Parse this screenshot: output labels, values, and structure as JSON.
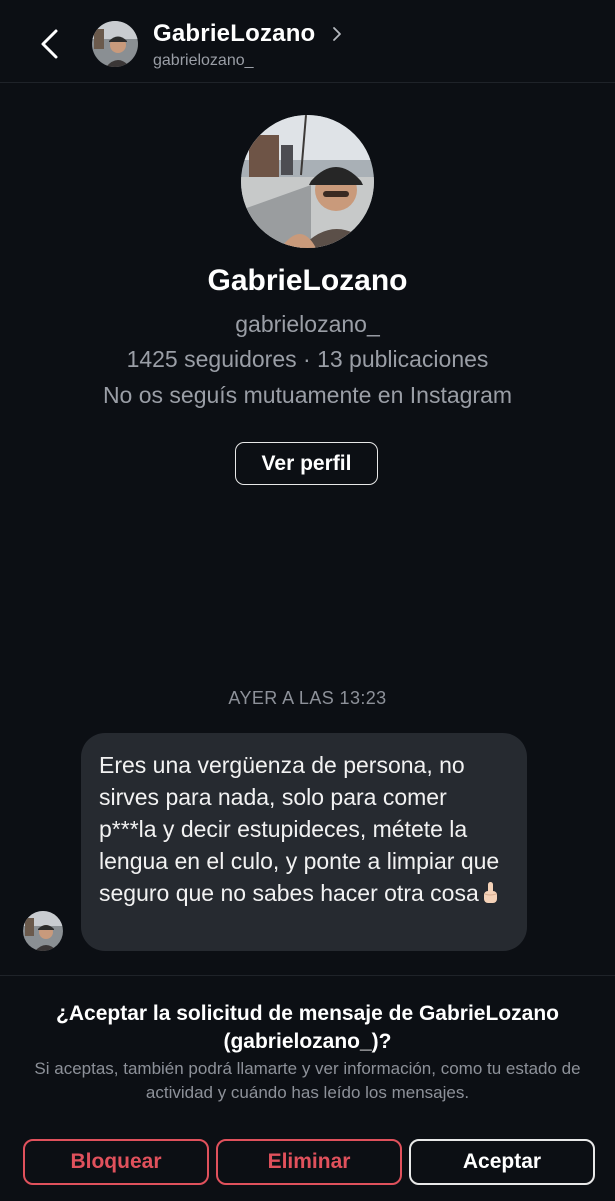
{
  "header": {
    "display_name": "GabrieLozano",
    "username": "gabrielozano_"
  },
  "profile": {
    "display_name": "GabrieLozano",
    "username": "gabrielozano_",
    "stats": "1425 seguidores · 13 publicaciones",
    "mutual": "No os seguís mutuamente en Instagram",
    "view_profile_label": "Ver perfil"
  },
  "conversation": {
    "timestamp": "AYER A LAS 13:23",
    "message_text": "Eres una vergüenza de persona, no sirves para nada, solo para comer p***la y decir estupideces, métete la lengua en el culo, y ponte a limpiar que seguro que no sabes hacer otra cosa"
  },
  "request": {
    "title": "¿Aceptar la solicitud de mensaje de GabrieLozano (gabrielozano_)?",
    "description": "Si aceptas, también podrá llamarte y ver información, como tu estado de actividad y cuándo has leído los mensajes.",
    "block_label": "Bloquear",
    "delete_label": "Eliminar",
    "accept_label": "Aceptar"
  },
  "colors": {
    "background": "#0c0f14",
    "bubble": "#262a30",
    "destructive": "#e0515c",
    "secondary_text": "#9a9ea6"
  },
  "icons": [
    "back-chevron-icon",
    "chevron-right-icon",
    "middle-finger-emoji-icon"
  ]
}
